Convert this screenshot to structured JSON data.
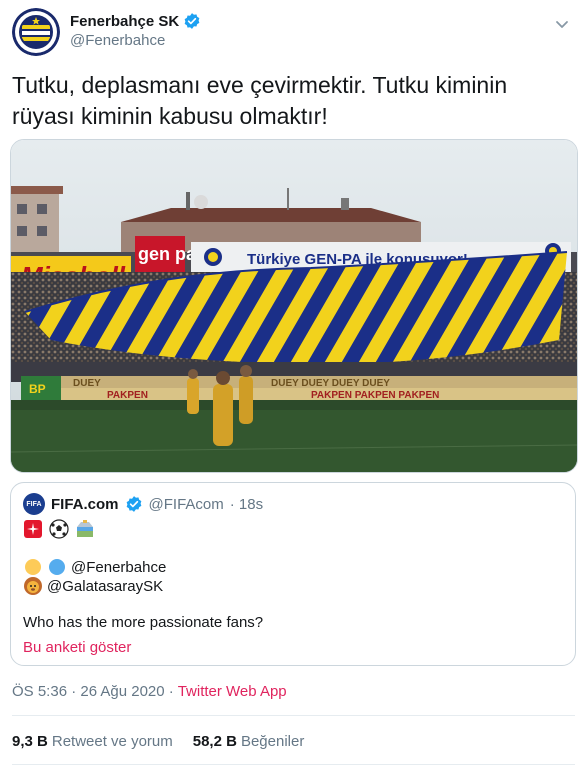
{
  "author": {
    "name": "Fenerbahçe SK",
    "handle": "@Fenerbahce",
    "avatar_icon": "fenerbahce-crest-icon",
    "avatar_text": "FENERBAHÇE SPOR KULÜBÜ 1907"
  },
  "tweet": {
    "text": "Tutku, deplasmanı eve çevirmektir. Tutku kiminin rüyası kiminin kabusu olmaktır!"
  },
  "media": {
    "signs": {
      "missboll": "Missboll",
      "genpa": "gen pa",
      "slogan": "Türkiye GEN-PA ile konuşuyor!",
      "duey": "DUEY",
      "pakpen": "PAKPEN",
      "bp": "BP"
    }
  },
  "quote": {
    "avatar_text": "FIFA",
    "name": "FIFA.com",
    "handle": "@FIFAcom",
    "time": "· 18s",
    "emojis": [
      "siren-emoji",
      "soccer-ball-emoji",
      "stadium-emoji"
    ],
    "mention1": "@Fenerbahce",
    "mention2": "@GalatasaraySK",
    "question": "Who has the more passionate fans?",
    "poll_link": "Bu anketi göster"
  },
  "meta": {
    "time": "ÖS 5:36 · 26 Ağu 2020 · ",
    "app": "Twitter Web App"
  },
  "stats": {
    "retweets_count": "9,3 B",
    "retweets_label": "Retweet ve yorum",
    "likes_count": "58,2 B",
    "likes_label": "Beğeniler"
  },
  "colors": {
    "link": "#e0245e",
    "verified": "#1da1f2",
    "stripe_yellow": "#f2d21c",
    "stripe_navy": "#1b2f88"
  }
}
